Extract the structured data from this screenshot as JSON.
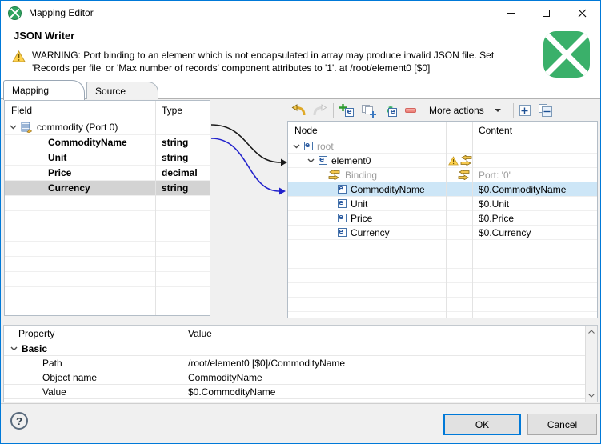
{
  "window": {
    "title": "Mapping Editor"
  },
  "header": {
    "component_name": "JSON Writer",
    "warning": "WARNING: Port binding to an element which is not encapsulated in array may produce invalid JSON file. Set 'Records per file' or 'Max number of records' component attributes to '1'. at /root/element0 [$0]"
  },
  "tabs": [
    {
      "label": "Mapping"
    },
    {
      "label": "Source"
    }
  ],
  "field_table": {
    "col_field": "Field",
    "col_type": "Type",
    "root_label": "commodity (Port 0)",
    "rows": [
      {
        "field": "CommodityName",
        "type": "string"
      },
      {
        "field": "Unit",
        "type": "string"
      },
      {
        "field": "Price",
        "type": "decimal"
      },
      {
        "field": "Currency",
        "type": "string",
        "selected": true
      }
    ]
  },
  "toolbar": {
    "more_actions": "More actions"
  },
  "node_table": {
    "col_node": "Node",
    "col_content": "Content",
    "rows": [
      {
        "label": "root",
        "content": ""
      },
      {
        "label": "element0",
        "content": ""
      },
      {
        "label": "Binding",
        "content": "Port: '0'"
      },
      {
        "label": "CommodityName",
        "content": "$0.CommodityName",
        "selected": true
      },
      {
        "label": "Unit",
        "content": "$0.Unit"
      },
      {
        "label": "Price",
        "content": "$0.Price"
      },
      {
        "label": "Currency",
        "content": "$0.Currency"
      }
    ]
  },
  "property_table": {
    "col_property": "Property",
    "col_value": "Value",
    "group": "Basic",
    "rows": [
      {
        "property": "Path",
        "value": "/root/element0 [$0]/CommodityName"
      },
      {
        "property": "Object name",
        "value": "CommodityName"
      },
      {
        "property": "Value",
        "value": "$0.CommodityName"
      }
    ]
  },
  "footer": {
    "help": "?",
    "ok": "OK",
    "cancel": "Cancel"
  },
  "icons": {
    "element_glyph": "e"
  },
  "colors": {
    "accent": "#0079d8",
    "clover_green": "#3ab06a",
    "warning_yellow": "#ffd24d",
    "selection_blue": "#cde6f7",
    "selection_gray": "#d3d3d3"
  }
}
